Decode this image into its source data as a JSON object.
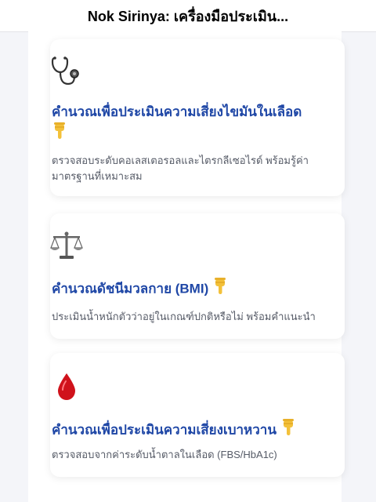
{
  "header": {
    "title": "Nok Sirinya: เครื่องมือประเมิน..."
  },
  "cards": [
    {
      "icon": "stethoscope-icon",
      "title": "คำนวณเพื่อประเมินความเสี่ยงไขมันในเลือด",
      "title_icon": "pointing-down-icon",
      "description": "ตรวจสอบระดับคอเลสเตอรอลและไตรกลีเซอไรด์    พร้อมรู้ค่ามาตรฐานที่เหมาะสม"
    },
    {
      "icon": "balance-scale-icon",
      "title": "คำนวณดัชนีมวลกาย (BMI)",
      "title_icon": "pointing-down-icon",
      "description": "ประเมินน้ำหนักตัวว่าอยู่ในเกณฑ์ปกติหรือไม่ พร้อมคำแนะนำ"
    },
    {
      "icon": "blood-drop-icon",
      "title": "คำนวณเพื่อประเมินความเสี่ยงเบาหวาน",
      "title_icon": "pointing-down-icon",
      "description": "ตรวจสอบจากค่าระดับน้ำตาลในเลือด (FBS/HbA1c)"
    }
  ],
  "colors": {
    "title": "#1f47a6",
    "description": "#555a66",
    "drop": "#d0121b"
  }
}
